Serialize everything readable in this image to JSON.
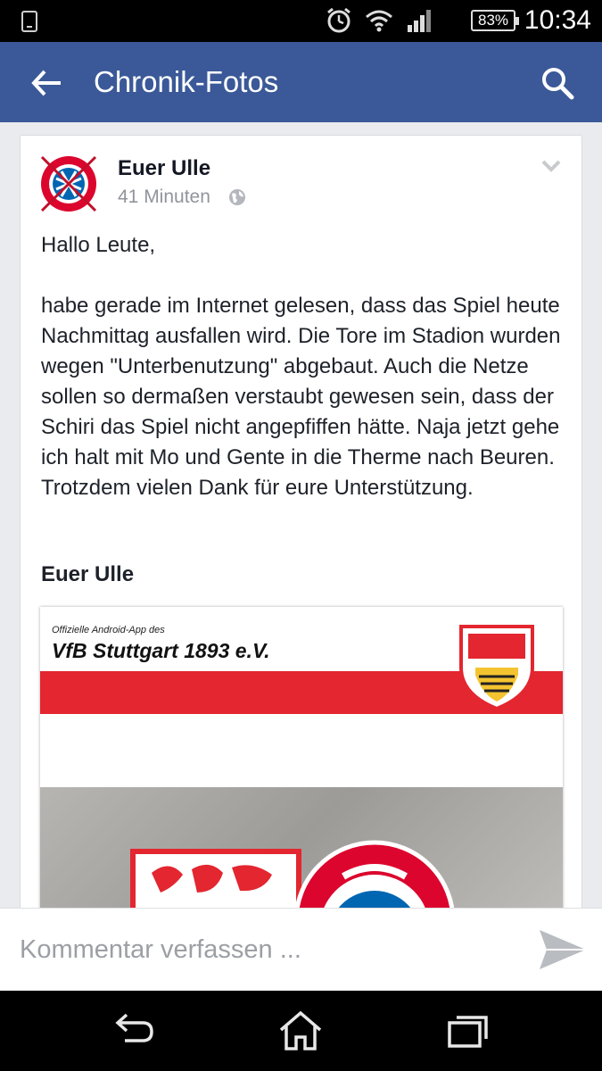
{
  "status_bar": {
    "battery": "83%",
    "time": "10:34"
  },
  "app_bar": {
    "title": "Chronik-Fotos"
  },
  "post": {
    "author": "Euer Ulle",
    "time_ago": "41 Minuten",
    "paragraphs": [
      "Hallo Leute,",
      "habe gerade im Internet gelesen, dass das Spiel heute Nachmittag ausfallen wird. Die Tore im Stadion wurden wegen \"Unterbenutzung\" abgebaut. Auch die Netze sollen so dermaßen verstaubt gewesen sein, dass der Schiri das Spiel nicht angepfiffen hätte. Naja jetzt gehe ich halt mit Mo und Gente in die Therme nach Beuren. Trotzdem vielen Dank für eure Unterstützung."
    ],
    "signature": "Euer Ulle",
    "attachment": {
      "small_caption": "Offizielle Android-App des",
      "club_name": "VfB Stuttgart 1893 e.V."
    }
  },
  "comment": {
    "placeholder": "Kommentar verfassen ..."
  },
  "icons": {
    "back": "arrow-left",
    "search": "magnifier",
    "privacy": "globe",
    "options": "chevron-down",
    "send": "paper-plane",
    "nav": [
      "back",
      "home",
      "recent-apps"
    ]
  },
  "colors": {
    "facebook_blue": "#3b5998",
    "vfb_red": "#e3262f"
  }
}
